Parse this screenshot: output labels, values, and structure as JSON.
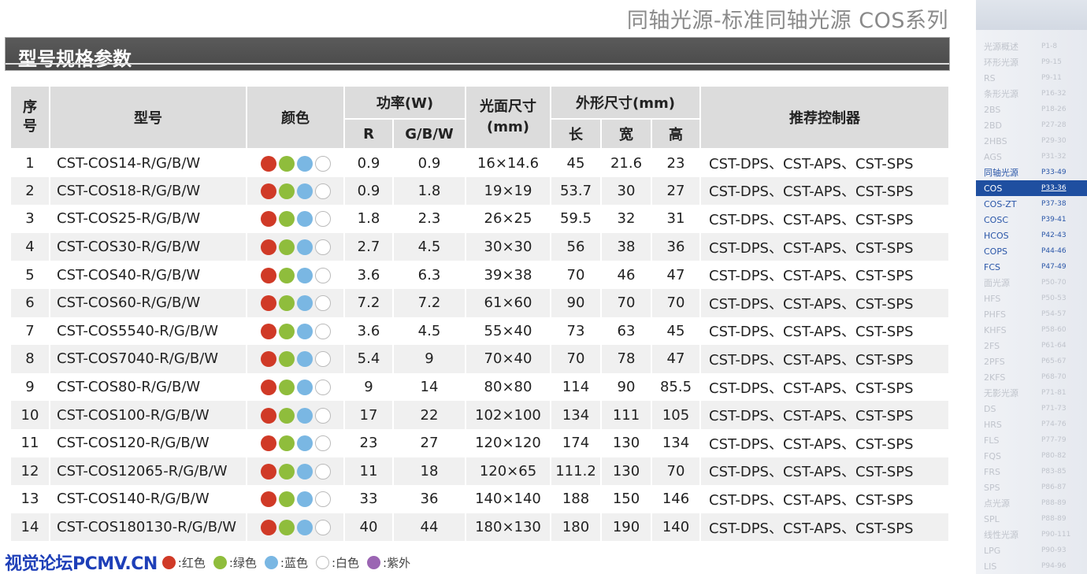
{
  "page_title": "同轴光源-标准同轴光源 COS系列",
  "section_title": "型号规格参数",
  "colors": {
    "red": "#d03a27",
    "green": "#8fbd3c",
    "blue": "#7ab7e3",
    "white": "#ffffff",
    "purple": "#9b65b3"
  },
  "table": {
    "headers": {
      "index": "序号",
      "model": "型号",
      "color": "颜色",
      "power": "功率(W)",
      "power_r": "R",
      "power_gbw": "G/B/W",
      "face_size": "光面尺寸(mm)",
      "outer_size": "外形尺寸(mm)",
      "length": "长",
      "width": "宽",
      "height": "高",
      "controller": "推荐控制器"
    },
    "rows": [
      {
        "no": "1",
        "model": "CST-COS14-R/G/B/W",
        "r": "0.9",
        "gbw": "0.9",
        "face": "16×14.6",
        "l": "45",
        "w": "21.6",
        "h": "23",
        "ctrl": "CST-DPS、CST-APS、CST-SPS"
      },
      {
        "no": "2",
        "model": "CST-COS18-R/G/B/W",
        "r": "0.9",
        "gbw": "1.8",
        "face": "19×19",
        "l": "53.7",
        "w": "30",
        "h": "27",
        "ctrl": "CST-DPS、CST-APS、CST-SPS"
      },
      {
        "no": "3",
        "model": "CST-COS25-R/G/B/W",
        "r": "1.8",
        "gbw": "2.3",
        "face": "26×25",
        "l": "59.5",
        "w": "32",
        "h": "31",
        "ctrl": "CST-DPS、CST-APS、CST-SPS"
      },
      {
        "no": "4",
        "model": "CST-COS30-R/G/B/W",
        "r": "2.7",
        "gbw": "4.5",
        "face": "30×30",
        "l": "56",
        "w": "38",
        "h": "36",
        "ctrl": "CST-DPS、CST-APS、CST-SPS"
      },
      {
        "no": "5",
        "model": "CST-COS40-R/G/B/W",
        "r": "3.6",
        "gbw": "6.3",
        "face": "39×38",
        "l": "70",
        "w": "46",
        "h": "47",
        "ctrl": "CST-DPS、CST-APS、CST-SPS"
      },
      {
        "no": "6",
        "model": "CST-COS60-R/G/B/W",
        "r": "7.2",
        "gbw": "7.2",
        "face": "61×60",
        "l": "90",
        "w": "70",
        "h": "70",
        "ctrl": "CST-DPS、CST-APS、CST-SPS"
      },
      {
        "no": "7",
        "model": "CST-COS5540-R/G/B/W",
        "r": "3.6",
        "gbw": "4.5",
        "face": "55×40",
        "l": "73",
        "w": "63",
        "h": "45",
        "ctrl": "CST-DPS、CST-APS、CST-SPS"
      },
      {
        "no": "8",
        "model": "CST-COS7040-R/G/B/W",
        "r": "5.4",
        "gbw": "9",
        "face": "70×40",
        "l": "70",
        "w": "78",
        "h": "47",
        "ctrl": "CST-DPS、CST-APS、CST-SPS"
      },
      {
        "no": "9",
        "model": "CST-COS80-R/G/B/W",
        "r": "9",
        "gbw": "14",
        "face": "80×80",
        "l": "114",
        "w": "90",
        "h": "85.5",
        "ctrl": "CST-DPS、CST-APS、CST-SPS"
      },
      {
        "no": "10",
        "model": "CST-COS100-R/G/B/W",
        "r": "17",
        "gbw": "22",
        "face": "102×100",
        "l": "134",
        "w": "111",
        "h": "105",
        "ctrl": "CST-DPS、CST-APS、CST-SPS"
      },
      {
        "no": "11",
        "model": "CST-COS120-R/G/B/W",
        "r": "23",
        "gbw": "27",
        "face": "120×120",
        "l": "174",
        "w": "130",
        "h": "134",
        "ctrl": "CST-DPS、CST-APS、CST-SPS"
      },
      {
        "no": "12",
        "model": "CST-COS12065-R/G/B/W",
        "r": "11",
        "gbw": "18",
        "face": "120×65",
        "l": "111.2",
        "w": "130",
        "h": "70",
        "ctrl": "CST-DPS、CST-APS、CST-SPS"
      },
      {
        "no": "13",
        "model": "CST-COS140-R/G/B/W",
        "r": "33",
        "gbw": "36",
        "face": "140×140",
        "l": "188",
        "w": "150",
        "h": "146",
        "ctrl": "CST-DPS、CST-APS、CST-SPS"
      },
      {
        "no": "14",
        "model": "CST-COS180130-R/G/B/W",
        "r": "40",
        "gbw": "44",
        "face": "180×130",
        "l": "180",
        "w": "190",
        "h": "140",
        "ctrl": "CST-DPS、CST-APS、CST-SPS"
      }
    ]
  },
  "legend": {
    "watermark": "视觉论坛PCMV.CN",
    "items": [
      {
        "color": "red",
        "label": ":红色"
      },
      {
        "color": "green",
        "label": ":绿色"
      },
      {
        "color": "blue",
        "label": ":蓝色"
      },
      {
        "color": "white",
        "label": ":白色"
      },
      {
        "color": "purple",
        "label": ":紫外"
      }
    ]
  },
  "sidebar": {
    "items": [
      {
        "name": "光源概述",
        "pages": "P1-8",
        "state": "dim"
      },
      {
        "name": "环形光源",
        "pages": "P9-15",
        "state": "dim"
      },
      {
        "name": "RS",
        "pages": "P9-11",
        "state": "dim"
      },
      {
        "name": "条形光源",
        "pages": "P16-32",
        "state": "dim"
      },
      {
        "name": "2BS",
        "pages": "P18-26",
        "state": "dim"
      },
      {
        "name": "2BD",
        "pages": "P27-28",
        "state": "dim"
      },
      {
        "name": "2HBS",
        "pages": "P29-30",
        "state": "dim"
      },
      {
        "name": "AGS",
        "pages": "P31-32",
        "state": "dim"
      },
      {
        "name": "同轴光源",
        "pages": "P33-49",
        "state": "blue"
      },
      {
        "name": "COS",
        "pages": "P33-36",
        "state": "active"
      },
      {
        "name": "COS-ZT",
        "pages": "P37-38",
        "state": "blue"
      },
      {
        "name": "COSC",
        "pages": "P39-41",
        "state": "blue"
      },
      {
        "name": "HCOS",
        "pages": "P42-43",
        "state": "blue"
      },
      {
        "name": "COPS",
        "pages": "P44-46",
        "state": "blue"
      },
      {
        "name": "FCS",
        "pages": "P47-49",
        "state": "blue"
      },
      {
        "name": "面光源",
        "pages": "P50-70",
        "state": "dim"
      },
      {
        "name": "HFS",
        "pages": "P50-53",
        "state": "dim"
      },
      {
        "name": "PHFS",
        "pages": "P54-57",
        "state": "dim"
      },
      {
        "name": "KHFS",
        "pages": "P58-60",
        "state": "dim"
      },
      {
        "name": "2FS",
        "pages": "P61-64",
        "state": "dim"
      },
      {
        "name": "2PFS",
        "pages": "P65-67",
        "state": "dim"
      },
      {
        "name": "2KFS",
        "pages": "P68-70",
        "state": "dim"
      },
      {
        "name": "无影光源",
        "pages": "P71-81",
        "state": "dim"
      },
      {
        "name": "DS",
        "pages": "P71-73",
        "state": "dim"
      },
      {
        "name": "HRS",
        "pages": "P74-76",
        "state": "dim"
      },
      {
        "name": "FLS",
        "pages": "P77-79",
        "state": "dim"
      },
      {
        "name": "FQS",
        "pages": "P80-82",
        "state": "dim"
      },
      {
        "name": "FRS",
        "pages": "P83-85",
        "state": "dim"
      },
      {
        "name": "SPS",
        "pages": "P86-87",
        "state": "dim"
      },
      {
        "name": "点光源",
        "pages": "P88-89",
        "state": "dim"
      },
      {
        "name": "SPL",
        "pages": "P88-89",
        "state": "dim"
      },
      {
        "name": "线性光源",
        "pages": "P90-111",
        "state": "dim"
      },
      {
        "name": "LPG",
        "pages": "P90-93",
        "state": "dim"
      },
      {
        "name": "LIS",
        "pages": "P94-96",
        "state": "dim"
      }
    ]
  }
}
